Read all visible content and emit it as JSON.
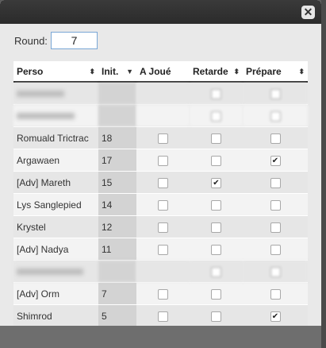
{
  "round": {
    "label": "Round:",
    "value": "7"
  },
  "table": {
    "headers": [
      "Perso",
      "Init.",
      "A Joué",
      "Retarde",
      "Prépare"
    ],
    "rows": [
      {
        "perso": "",
        "init": "",
        "a_joue": false,
        "retarde": false,
        "prepare": false,
        "blurred": true
      },
      {
        "perso": "",
        "init": "",
        "a_joue": false,
        "retarde": false,
        "prepare": false,
        "blurred": true
      },
      {
        "perso": "Romuald Trictrac",
        "init": "18",
        "a_joue": false,
        "retarde": false,
        "prepare": false
      },
      {
        "perso": "Argawaen",
        "init": "17",
        "a_joue": false,
        "retarde": false,
        "prepare": true
      },
      {
        "perso": "[Adv] Mareth",
        "init": "15",
        "a_joue": false,
        "retarde": true,
        "prepare": false
      },
      {
        "perso": "Lys Sanglepied",
        "init": "14",
        "a_joue": false,
        "retarde": false,
        "prepare": false
      },
      {
        "perso": "Krystel",
        "init": "12",
        "a_joue": false,
        "retarde": false,
        "prepare": false
      },
      {
        "perso": "[Adv] Nadya",
        "init": "11",
        "a_joue": false,
        "retarde": false,
        "prepare": false
      },
      {
        "perso": "",
        "init": "",
        "a_joue": false,
        "retarde": false,
        "prepare": false,
        "blurred": true
      },
      {
        "perso": "[Adv] Orm",
        "init": "7",
        "a_joue": false,
        "retarde": false,
        "prepare": false
      },
      {
        "perso": "Shimrod",
        "init": "5",
        "a_joue": false,
        "retarde": false,
        "prepare": true
      }
    ]
  },
  "icons": {
    "close": "close-icon",
    "check": "checkmark-icon",
    "sort_both": "sort-both-icon",
    "sort_desc": "sort-desc-icon"
  }
}
